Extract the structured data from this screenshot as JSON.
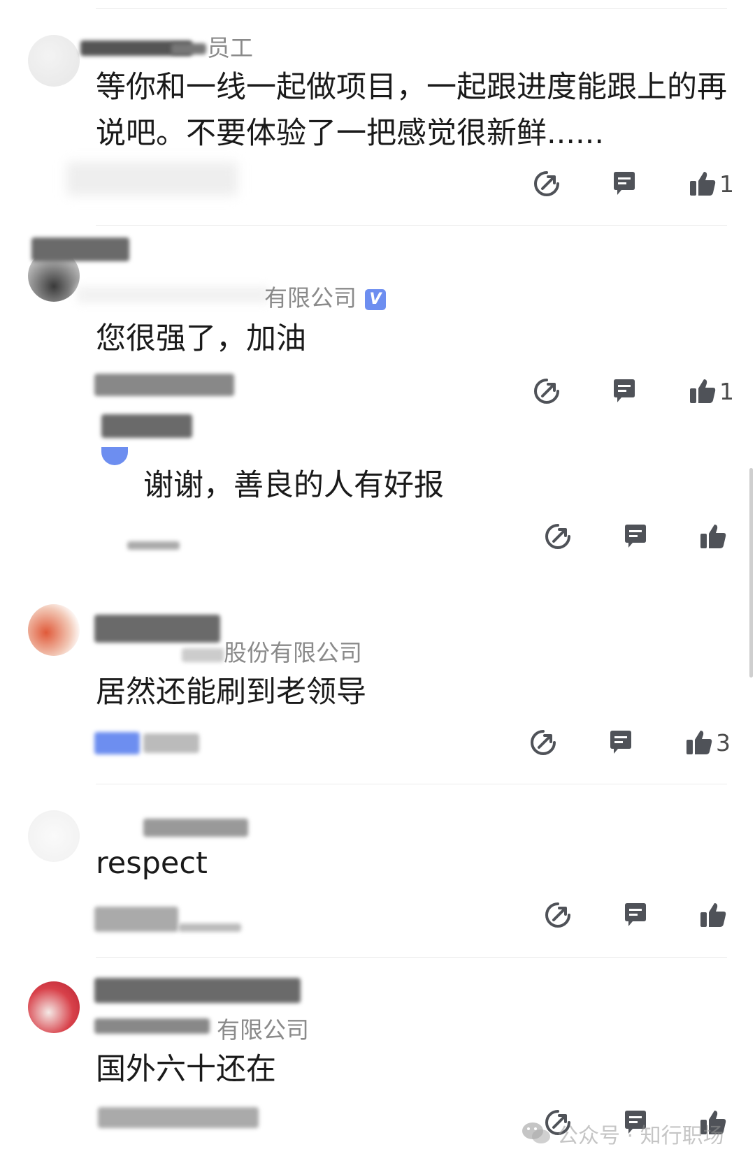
{
  "comments": [
    {
      "user_suffix": "员工",
      "company_suffix": "",
      "text": "等你和一线一起做项目，一起跟进度能跟上的再说吧。不要体验了一把感觉很新鲜......",
      "like_count": "1"
    },
    {
      "user_suffix": "",
      "company_suffix": "有限公司",
      "verified_badge": "V",
      "text": "您很强了，加油",
      "like_count": "1",
      "reply": {
        "text": "谢谢，善良的人有好报",
        "like_count": ""
      }
    },
    {
      "user_suffix": "",
      "company_suffix": "股份有限公司",
      "text": "居然还能刷到老领导",
      "like_count": "3"
    },
    {
      "user_suffix": "",
      "company_suffix": "",
      "text": "respect",
      "like_count": ""
    },
    {
      "user_suffix": "",
      "company_suffix": "有限公司",
      "text": "国外六十还在",
      "like_count": ""
    }
  ],
  "icons": {
    "share": "share-icon",
    "reply": "reply-bubble-icon",
    "like": "thumbs-up-icon"
  },
  "colors": {
    "icon": "#4f5258",
    "verified": "#6d8ef0"
  },
  "watermark": {
    "label": "公众号 · 知行职场"
  }
}
